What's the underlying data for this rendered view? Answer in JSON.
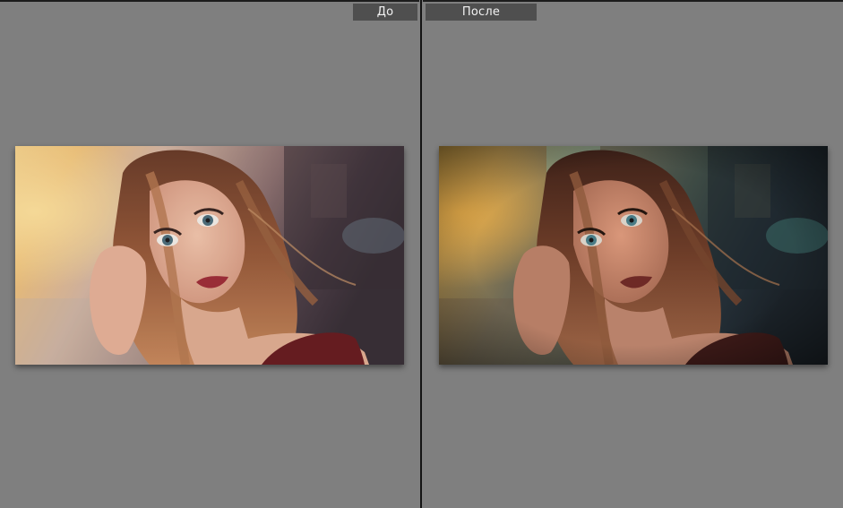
{
  "compare_view": {
    "before_label": "До",
    "after_label": "После"
  },
  "colors": {
    "background": "#7f7f7f",
    "label_bg": "#4f4f4f",
    "label_text": "#f2f2f2",
    "divider": "#141414"
  }
}
